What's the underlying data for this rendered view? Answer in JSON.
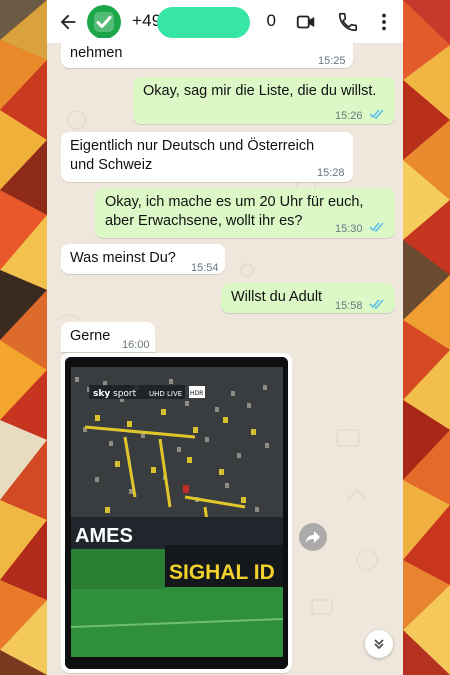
{
  "header": {
    "phone_number_visible_start": "+49",
    "phone_number_visible_end": "0",
    "back_icon": "arrow-left-icon",
    "avatar_icon": "check-badge-icon",
    "video_icon": "video-camera-icon",
    "call_icon": "phone-icon",
    "menu_icon": "more-vertical-icon"
  },
  "messages": [
    {
      "direction": "incoming",
      "text": "nehmen",
      "time": "15:25"
    },
    {
      "direction": "outgoing",
      "text": "Okay, sag mir die Liste, die du willst.",
      "time": "15:26",
      "read": true
    },
    {
      "direction": "incoming",
      "text_line1": "Eigentlich nur Deutsch und Österreich",
      "text_line2": "und Schweiz",
      "time": "15:28"
    },
    {
      "direction": "outgoing",
      "text_line1": "Okay, ich mache es um 20 Uhr für euch,",
      "text_line2": "aber Erwachsene, wollt ihr es?",
      "time": "15:30",
      "read": true
    },
    {
      "direction": "incoming",
      "text": "Was meinst Du?",
      "time": "15:54"
    },
    {
      "direction": "outgoing",
      "text": "Willst du Adult",
      "time": "15:58",
      "read": true
    },
    {
      "direction": "incoming",
      "text": "Gerne",
      "time": "16:00"
    }
  ],
  "media": {
    "broadcaster": "sky",
    "channel": "sport",
    "badge_uhd": "UHD",
    "badge_live": "LIVE",
    "badge_hdr": "HDR",
    "banner_left": "AMES",
    "banner_right": "SIGHAL ID",
    "forward_icon": "forward-arrow-icon"
  },
  "colors": {
    "outgoing_bubble": "#dcf8c6",
    "incoming_bubble": "#ffffff",
    "read_ticks": "#53bdeb",
    "chat_background": "#efe7dc",
    "redaction": "#37e6a4"
  },
  "scroll_icon": "chevron-double-down-icon"
}
